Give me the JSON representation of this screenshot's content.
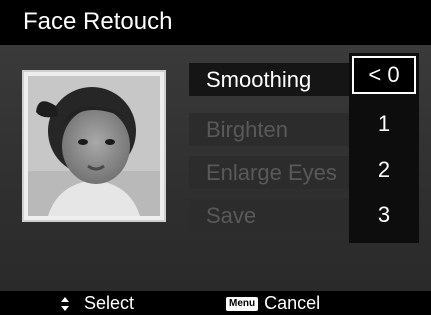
{
  "title": "Face Retouch",
  "menu": {
    "items": [
      {
        "label": "Smoothing",
        "selected": true
      },
      {
        "label": "Birghten",
        "selected": false
      },
      {
        "label": "Enlarge Eyes",
        "selected": false
      },
      {
        "label": "Save",
        "selected": false
      }
    ]
  },
  "values": {
    "current": "< 0",
    "options": [
      "1",
      "2",
      "3"
    ]
  },
  "footer": {
    "select_label": "Select",
    "menu_badge": "Menu",
    "cancel_label": "Cancel"
  }
}
